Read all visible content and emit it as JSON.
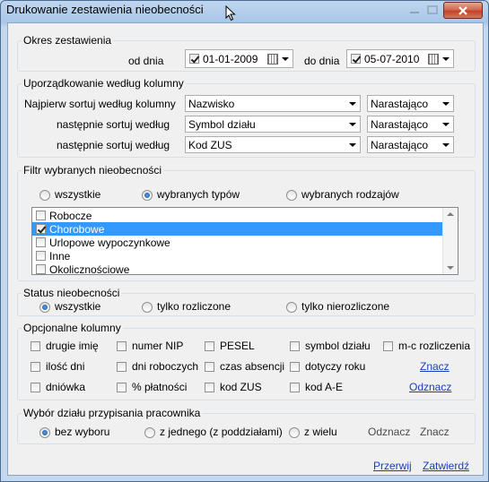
{
  "window": {
    "title": "Drukowanie zestawienia nieobecności"
  },
  "period": {
    "legend": "Okres zestawienia",
    "from_label": "od dnia",
    "from_value": "01-01-2009",
    "from_checked": true,
    "to_label": "do dnia",
    "to_value": "05-07-2010",
    "to_checked": true
  },
  "sorting": {
    "legend": "Uporządkowanie według kolumny",
    "rows": [
      {
        "label": "Najpierw sortuj według kolumny",
        "column": "Nazwisko",
        "order": "Narastająco"
      },
      {
        "label": "następnie sortuj według",
        "column": "Symbol działu",
        "order": "Narastająco"
      },
      {
        "label": "następnie sortuj według",
        "column": "Kod ZUS",
        "order": "Narastająco"
      }
    ]
  },
  "filter": {
    "legend": "Filtr wybranych nieobecności",
    "radios": [
      {
        "label": "wszystkie",
        "checked": false
      },
      {
        "label": "wybranych typów",
        "checked": true
      },
      {
        "label": "wybranych rodzajów",
        "checked": false
      }
    ],
    "items": [
      {
        "label": "Robocze",
        "checked": false,
        "selected": false
      },
      {
        "label": "Chorobowe",
        "checked": true,
        "selected": true
      },
      {
        "label": "Urlopowe wypoczynkowe",
        "checked": false,
        "selected": false
      },
      {
        "label": "Inne",
        "checked": false,
        "selected": false
      },
      {
        "label": "Okolicznościowe",
        "checked": false,
        "selected": false
      }
    ]
  },
  "status": {
    "legend": "Status nieobecności",
    "radios": [
      {
        "label": "wszystkie",
        "checked": true
      },
      {
        "label": "tylko rozliczone",
        "checked": false
      },
      {
        "label": "tylko nierozliczone",
        "checked": false
      }
    ]
  },
  "columns": {
    "legend": "Opcjonalne kolumny",
    "row1": [
      "drugie imię",
      "numer NIP",
      "PESEL",
      "symbol działu",
      "m-c rozliczenia"
    ],
    "row2": [
      "ilość dni",
      "dni roboczych",
      "czas absencji",
      "dotyczy roku"
    ],
    "row3": [
      "dniówka",
      "% płatności",
      "kod ZUS",
      "kod A-E"
    ],
    "select_all": "Znacz",
    "deselect_all": "Odznacz"
  },
  "department": {
    "legend": "Wybór działu przypisania pracownika",
    "radios": [
      {
        "label": "bez wyboru",
        "checked": true
      },
      {
        "label": "z jednego (z poddziałami)",
        "checked": false
      },
      {
        "label": "z wielu",
        "checked": false
      }
    ],
    "deselect": "Odznacz",
    "select": "Znacz"
  },
  "footer": {
    "cancel": "Przerwij",
    "confirm": "Zatwierdź"
  }
}
